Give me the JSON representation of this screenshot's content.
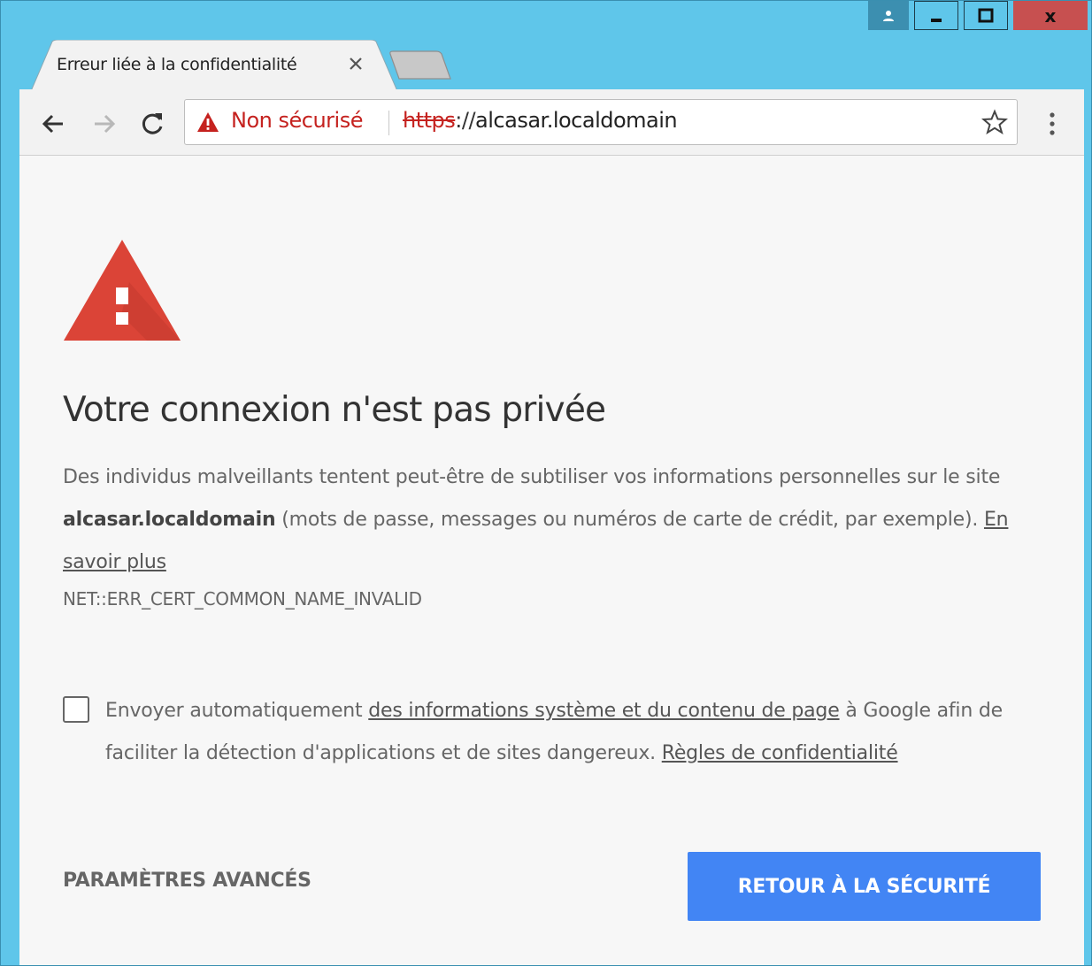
{
  "window": {
    "controls": {
      "user_icon": "person-icon",
      "minimize_icon": "minimize-icon",
      "maximize_icon": "maximize-icon",
      "close_label": "x"
    }
  },
  "tabs": [
    {
      "title": "Erreur liée à la confidentialité",
      "active": true,
      "close_icon": "close-icon"
    }
  ],
  "toolbar": {
    "back_icon": "arrow-left-icon",
    "forward_icon": "arrow-right-icon",
    "reload_icon": "reload-icon",
    "security_icon": "warning-triangle-icon",
    "security_label": "Non sécurisé",
    "url_scheme": "https",
    "url_separator": "://",
    "url_host": "alcasar.localdomain",
    "bookmark_icon": "star-icon",
    "menu_icon": "three-dots-vertical-icon"
  },
  "interstitial": {
    "icon": "warning-triangle-icon",
    "heading": "Votre connexion n'est pas privée",
    "desc_part1": "Des individus malveillants tentent peut-être de subtiliser vos informations personnelles sur le site ",
    "desc_host": "alcasar.localdomain",
    "desc_part2": " (mots de passe, messages ou numéros de carte de crédit, par exemple). ",
    "learn_more": "En savoir plus",
    "error_code": "NET::ERR_CERT_COMMON_NAME_INVALID",
    "optin_part1": "Envoyer automatiquement ",
    "optin_link": "des informations système et du contenu de page",
    "optin_part2": " à Google afin de faciliter la détection d'applications et de sites dangereux. ",
    "privacy_link": "Règles de confidentialité",
    "optin_checked": false,
    "advanced_button": "PARAMÈTRES AVANCÉS",
    "back_button": "RETOUR À LA SÉCURITÉ"
  },
  "colors": {
    "titlebar": "#5fc6ea",
    "close_button": "#c75050",
    "danger": "#c5221f",
    "warning_icon": "#db4437",
    "primary_button": "#4285f4",
    "page_background": "#f7f7f7"
  }
}
